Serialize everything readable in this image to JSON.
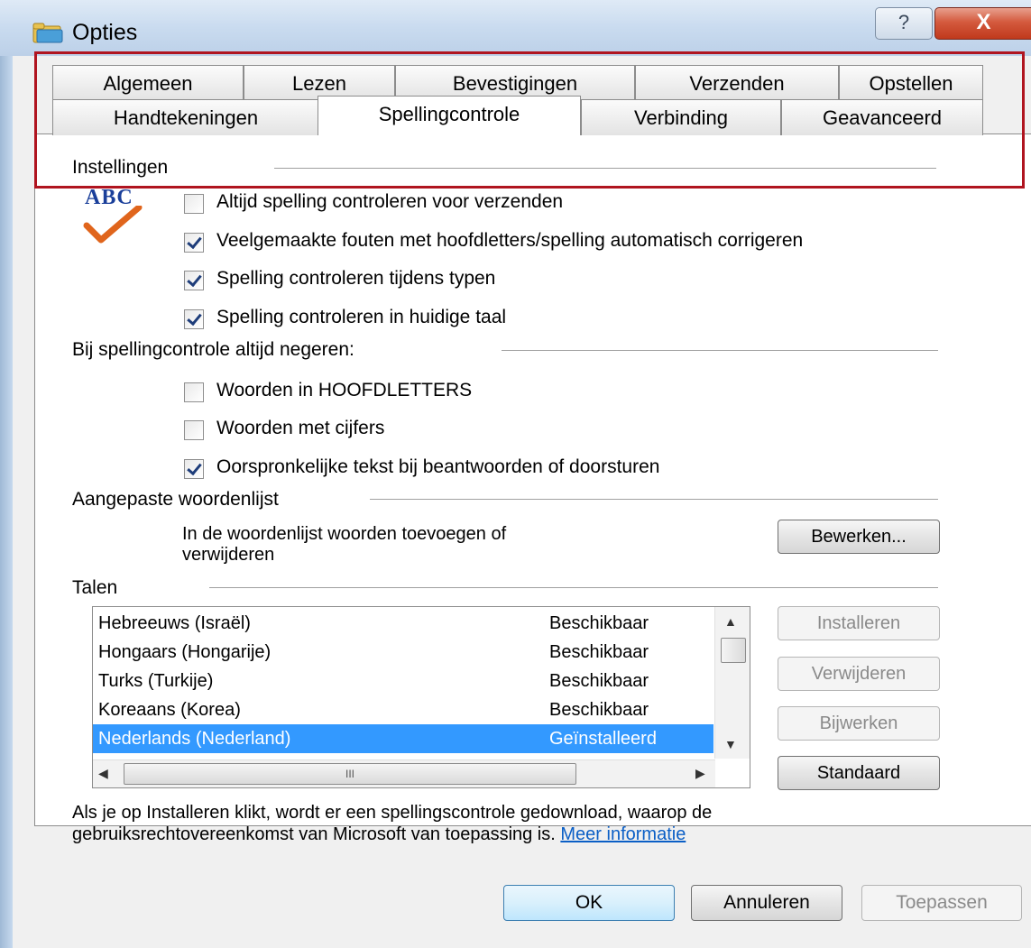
{
  "window": {
    "title": "Opties",
    "help_label": "?",
    "close_label": "X"
  },
  "tabs": {
    "row1": [
      "Algemeen",
      "Lezen",
      "Bevestigingen",
      "Verzenden",
      "Opstellen"
    ],
    "row2": [
      "Handtekeningen",
      "Spellingcontrole",
      "Verbinding",
      "Geavanceerd"
    ],
    "active": "Spellingcontrole"
  },
  "settings": {
    "heading": "Instellingen",
    "logo_text": "ABC",
    "checks": [
      {
        "label": "Altijd spelling controleren voor verzenden",
        "checked": false
      },
      {
        "label": "Veelgemaakte fouten met hoofdletters/spelling automatisch corrigeren",
        "checked": true
      },
      {
        "label": "Spelling controleren tijdens typen",
        "checked": true
      },
      {
        "label": "Spelling controleren in huidige taal",
        "checked": true
      }
    ]
  },
  "ignore": {
    "heading": "Bij spellingcontrole altijd negeren:",
    "checks": [
      {
        "label": "Woorden in HOOFDLETTERS",
        "checked": false
      },
      {
        "label": "Woorden met cijfers",
        "checked": false
      },
      {
        "label": "Oorspronkelijke tekst bij beantwoorden of doorsturen",
        "checked": true
      }
    ]
  },
  "custom_dictionary": {
    "heading": "Aangepaste woordenlijst",
    "description_line1": "In de woordenlijst woorden toevoegen of",
    "description_line2": "verwijderen",
    "edit_button": "Bewerken..."
  },
  "languages": {
    "heading": "Talen",
    "rows": [
      {
        "name": "Hebreeuws (Israël)",
        "status": "Beschikbaar",
        "selected": false
      },
      {
        "name": "Hongaars (Hongarije)",
        "status": "Beschikbaar",
        "selected": false
      },
      {
        "name": "Turks (Turkije)",
        "status": "Beschikbaar",
        "selected": false
      },
      {
        "name": "Koreaans (Korea)",
        "status": "Beschikbaar",
        "selected": false
      },
      {
        "name": "Nederlands (Nederland)",
        "status": "Geïnstalleerd",
        "selected": true
      }
    ],
    "buttons": {
      "install": "Installeren",
      "remove": "Verwijderen",
      "update": "Bijwerken",
      "default": "Standaard"
    },
    "hscroll_grip": "III"
  },
  "notice": {
    "line1": "Als je op Installeren klikt, wordt er een spellingscontrole gedownload, waarop de",
    "line2": "gebruiksrechtovereenkomst van Microsoft van toepassing is. ",
    "link": "Meer informatie"
  },
  "footer": {
    "ok": "OK",
    "cancel": "Annuleren",
    "apply": "Toepassen"
  }
}
